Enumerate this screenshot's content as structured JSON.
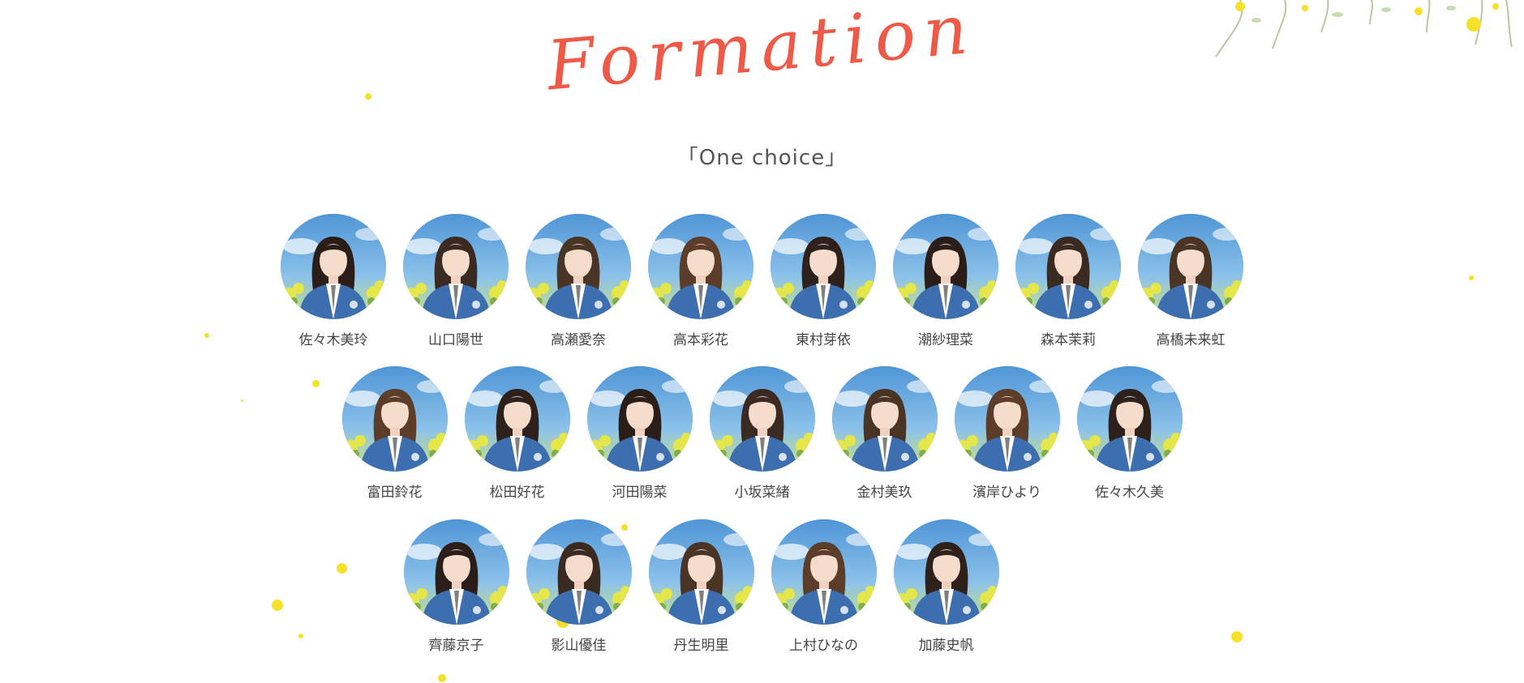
{
  "header": {
    "title": "Formation",
    "subtitle": "「One choice」"
  },
  "colors": {
    "title": "#ee5a48",
    "petal": "#f5e12a",
    "jacket": "#3d6fb0",
    "sky": "#6aaae0",
    "flowers": "#d8e34a",
    "name_text": "#444444"
  },
  "members": {
    "row1": [
      {
        "name": "佐々木美玲"
      },
      {
        "name": "山口陽世"
      },
      {
        "name": "高瀬愛奈"
      },
      {
        "name": "高本彩花"
      },
      {
        "name": "東村芽依"
      },
      {
        "name": "潮紗理菜"
      },
      {
        "name": "森本茉莉"
      },
      {
        "name": "高橋未来虹"
      }
    ],
    "row2": [
      {
        "name": "富田鈴花"
      },
      {
        "name": "松田好花"
      },
      {
        "name": "河田陽菜"
      },
      {
        "name": "小坂菜緒"
      },
      {
        "name": "金村美玖"
      },
      {
        "name": "濱岸ひより"
      },
      {
        "name": "佐々木久美"
      }
    ],
    "row3": [
      {
        "name": "齊藤京子"
      },
      {
        "name": "影山優佳"
      },
      {
        "name": "丹生明里"
      },
      {
        "name": "上村ひなの"
      },
      {
        "name": "加藤史帆"
      }
    ]
  }
}
